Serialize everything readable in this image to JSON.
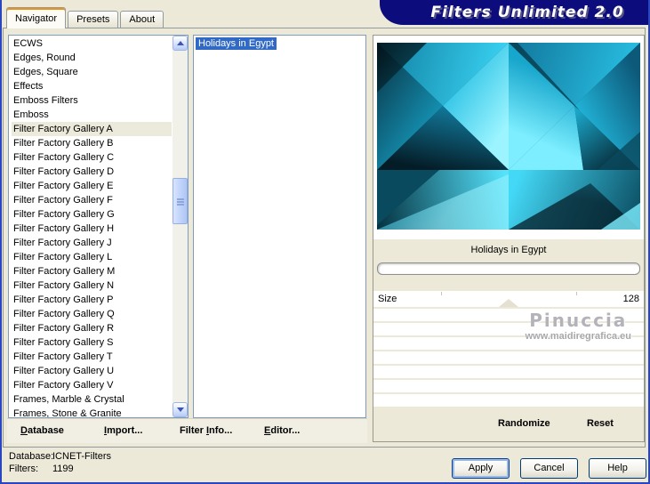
{
  "window": {
    "title": "Filters Unlimited 2.0"
  },
  "tabs": [
    {
      "label": "Navigator"
    },
    {
      "label": "Presets"
    },
    {
      "label": "About"
    }
  ],
  "category_list": {
    "selected": "Filter Factory Gallery A",
    "items": [
      "ECWS",
      "Edges, Round",
      "Edges, Square",
      "Effects",
      "Emboss Filters",
      "Emboss",
      "Filter Factory Gallery A",
      "Filter Factory Gallery B",
      "Filter Factory Gallery C",
      "Filter Factory Gallery D",
      "Filter Factory Gallery E",
      "Filter Factory Gallery F",
      "Filter Factory Gallery G",
      "Filter Factory Gallery H",
      "Filter Factory Gallery J",
      "Filter Factory Gallery L",
      "Filter Factory Gallery M",
      "Filter Factory Gallery N",
      "Filter Factory Gallery P",
      "Filter Factory Gallery Q",
      "Filter Factory Gallery R",
      "Filter Factory Gallery S",
      "Filter Factory Gallery T",
      "Filter Factory Gallery U",
      "Filter Factory Gallery V",
      "Frames, Marble & Crystal",
      "Frames, Stone & Granite"
    ]
  },
  "filter_list": {
    "selected": "Holidays in Egypt",
    "items": [
      "Holidays in Egypt"
    ]
  },
  "preview": {
    "caption": "Holidays in Egypt",
    "watermark_title": "Pinuccia",
    "watermark_url": "www.maidiregrafica.eu"
  },
  "controls": {
    "size_label": "Size",
    "size_value": "128"
  },
  "actions": {
    "database": {
      "pre": "",
      "accel": "D",
      "post": "atabase"
    },
    "import_": {
      "pre": "",
      "accel": "I",
      "post": "mport..."
    },
    "filter_info": {
      "pre": "Filter ",
      "accel": "I",
      "post": "nfo..."
    },
    "editor": {
      "pre": "",
      "accel": "E",
      "post": "ditor..."
    },
    "randomize": "Randomize",
    "reset": "Reset"
  },
  "status": {
    "database_label": "Database:",
    "database_value": "ICNET-Filters",
    "filters_label": "Filters:",
    "filters_value": "1199"
  },
  "buttons": {
    "apply": "Apply",
    "cancel": "Cancel",
    "help": "Help"
  },
  "colors": {
    "window_background": "#ECE9D8",
    "banner_navy": "#0D0C7C",
    "selection_blue": "#316AC5",
    "tab_accent_orange": "#EE9311",
    "window_border_blue": "#2946C0",
    "preview_cyan_bright": "#7DEEFF",
    "preview_cyan_mid": "#1BA6C8",
    "preview_teal_dark": "#052330"
  }
}
